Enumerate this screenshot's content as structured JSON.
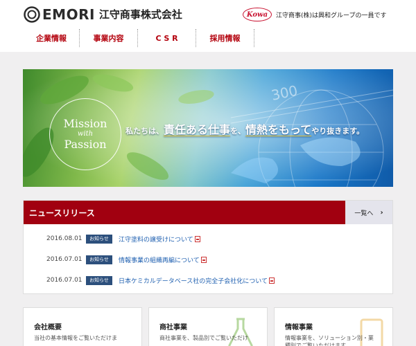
{
  "header": {
    "logo_text": "EMORI",
    "logo_jp": "江守商事株式会社",
    "partner_logo": "Kowa",
    "group_note": "江守商事(株)は興和グループの一員です",
    "nav": [
      {
        "label": "企業情報"
      },
      {
        "label": "事業内容"
      },
      {
        "label": "C S R"
      },
      {
        "label": "採用情報"
      }
    ]
  },
  "hero": {
    "mission_line1": "Mission",
    "mission_line2": "with",
    "mission_line3": "Passion",
    "tagline_part1": "私たちは、",
    "tagline_part2": "責任ある仕事",
    "tagline_part3": "を、",
    "tagline_part4": "情熱をもって",
    "tagline_part5": "やり抜きます。",
    "bg_number": "300"
  },
  "news": {
    "title": "ニュースリリース",
    "more_label": "一覧へ",
    "more_arrow": "›",
    "items": [
      {
        "date": "2016.08.01",
        "badge": "お知らせ",
        "text": "江守塗料の譲受けについて"
      },
      {
        "date": "2016.07.01",
        "badge": "お知らせ",
        "text": "情報事業の組織再編について"
      },
      {
        "date": "2016.07.01",
        "badge": "お知らせ",
        "text": "日本ケミカルデータベース社の完全子会社化について"
      }
    ]
  },
  "cards": [
    {
      "title": "会社概要",
      "desc": "当社の基本情報をご覧いただけま"
    },
    {
      "title": "商社事業",
      "desc": "商社事業を、製品別でご覧いただけ"
    },
    {
      "title": "情報事業",
      "desc": "情報事業を、ソリューション別・業種別でご覧いただけます"
    }
  ],
  "colors": {
    "brand_red": "#a10010",
    "nav_red": "#b3000c",
    "badge_navy": "#2c4f7c",
    "link_blue": "#1e5fb0"
  },
  "icons": [
    "emori-logo-icon",
    "kowa-logo-icon",
    "pdf-icon",
    "flask-icon",
    "chevron-right-icon"
  ]
}
